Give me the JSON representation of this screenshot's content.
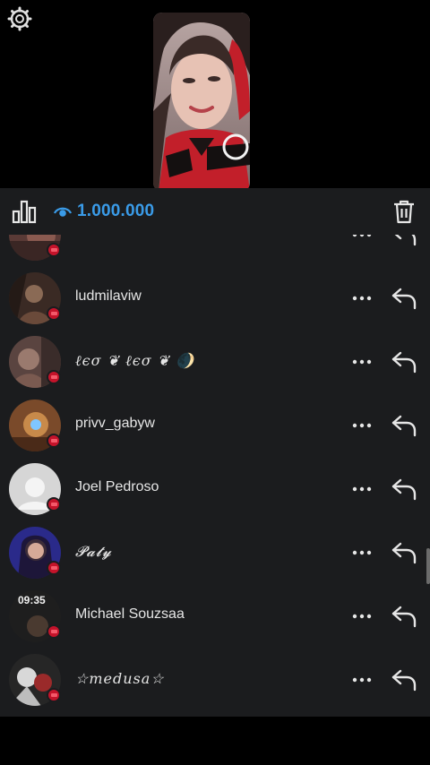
{
  "header": {
    "settings_icon": "gear-icon",
    "stream_thumbnail": "live-video-thumbnail"
  },
  "toolbar": {
    "stats_icon": "bar-chart-icon",
    "viewer_icon": "eye-icon",
    "viewer_count": "1.000.000",
    "delete_icon": "trash-icon",
    "accent": "#3a9be8"
  },
  "list": {
    "items": [
      {
        "name": "",
        "badge_color": "#c4132a"
      },
      {
        "name": "ludmilaviw"
      },
      {
        "name": "ℓєσ ❦ ℓєσ ❦ 🌒"
      },
      {
        "name": "privv_gabyw"
      },
      {
        "name": "Joel Pedroso"
      },
      {
        "name": "𝓟𝓪𝓽𝔂"
      },
      {
        "name": "Michael Souzsaa",
        "time_label": "09:35"
      },
      {
        "name": "☆medusa☆"
      }
    ],
    "more_icon": "more-dots-icon",
    "reply_icon": "reply-arrow-icon"
  }
}
